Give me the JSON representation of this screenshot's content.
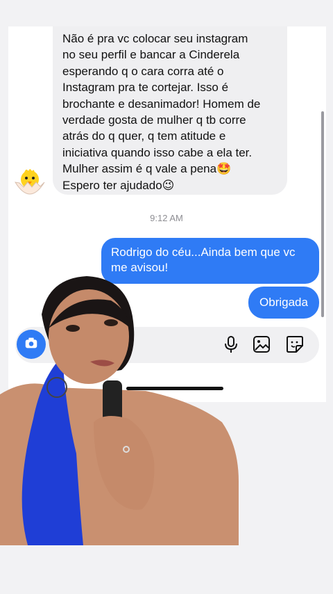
{
  "chat": {
    "incoming_message": "Não é pra vc colocar seu instagram\nno seu perfil e bancar a Cinderela\nesperando q o cara corra até o\nInstagram pra te cortejar. Isso é\nbrochante e desanimador! Homem de\nverdade gosta de mulher q tb corre\natrás do q quer, q tem atitude e\niniciativa quando isso cabe a ela ter.\nMulher assim é q vale a pena🤩\nEspero ter ajudado😉",
    "timestamp": "9:12 AM",
    "outgoing_messages": [
      "Rodrigo do céu...Ainda bem que vc me avisou!",
      "Obrigada"
    ]
  },
  "composer": {
    "icons": [
      "camera-icon",
      "microphone-icon",
      "gallery-icon",
      "sticker-icon"
    ]
  },
  "colors": {
    "outgoing_bubble": "#2f7bf5",
    "incoming_bubble": "#efeff1",
    "background": "#f2f2f4"
  }
}
